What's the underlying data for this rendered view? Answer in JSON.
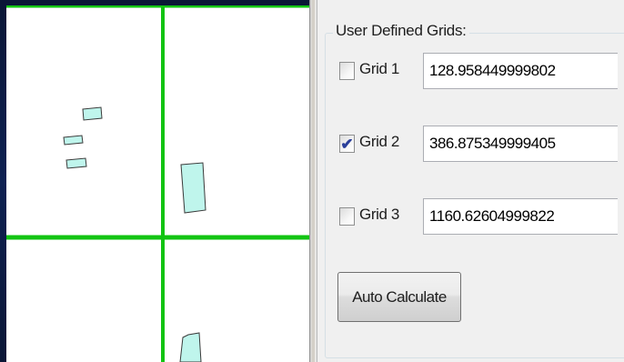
{
  "colors": {
    "grid_line": "#12c412",
    "parcel_fill": "#bff5ec",
    "parcel_stroke": "#3a3a3a"
  },
  "panel": {
    "group_title": "User Defined Grids:",
    "grids": [
      {
        "label": "Grid 1",
        "checked": false,
        "value": "128.958449999802"
      },
      {
        "label": "Grid 2",
        "checked": true,
        "value": "386.875349999405"
      },
      {
        "label": "Grid 3",
        "checked": false,
        "value": "1160.62604999822"
      }
    ],
    "auto_calculate_label": "Auto Calculate"
  },
  "icons": {
    "check": "checkmark-icon"
  }
}
